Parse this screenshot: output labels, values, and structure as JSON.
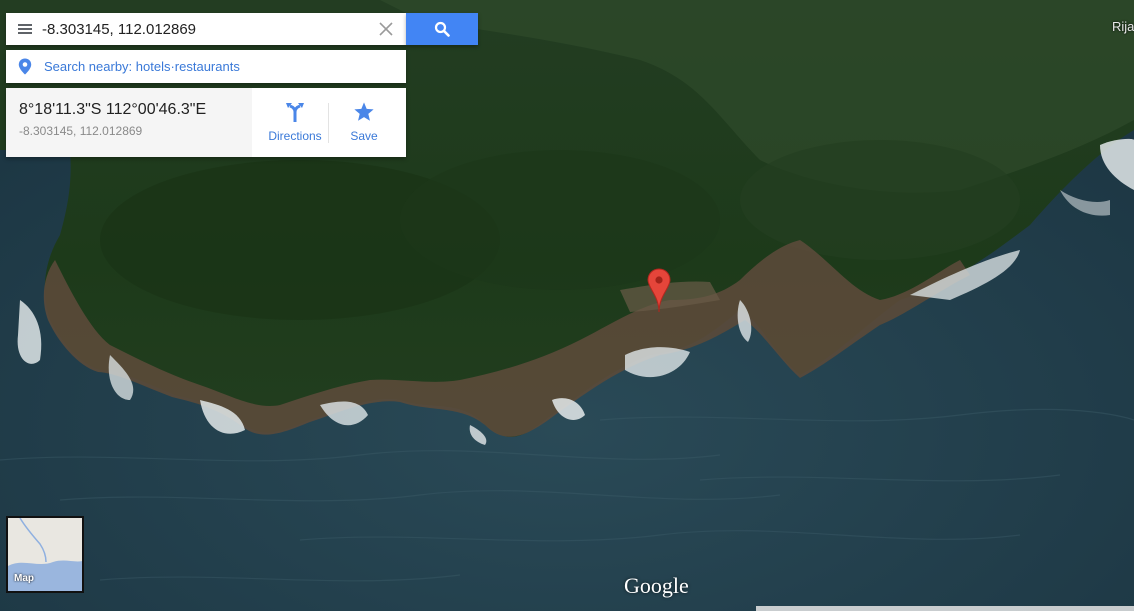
{
  "search": {
    "query": "-8.303145, 112.012869"
  },
  "nearby": {
    "label": "Search nearby: hotels·restaurants"
  },
  "place": {
    "dms": "8°18'11.3\"S 112°00'46.3\"E",
    "decimal": "-8.303145, 112.012869",
    "directions_label": "Directions",
    "save_label": "Save"
  },
  "map": {
    "corner_label": "Rija",
    "thumb_label": "Map",
    "logo": "Google",
    "marker_color": "#e5453a",
    "accent": "#4285f4",
    "link_color": "#3a79d8"
  },
  "icons": [
    "menu-icon",
    "close-icon",
    "search-icon",
    "location-pin-icon",
    "directions-icon",
    "star-icon",
    "map-marker-icon"
  ]
}
